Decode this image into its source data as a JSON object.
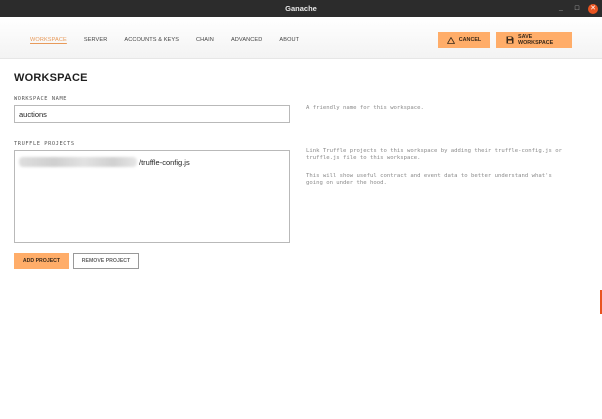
{
  "window": {
    "title": "Ganache",
    "minimize_glyph": "_",
    "maximize_glyph": "□",
    "close_glyph": "✕"
  },
  "nav": {
    "tabs": [
      {
        "label": "WORKSPACE",
        "active": true
      },
      {
        "label": "SERVER",
        "active": false
      },
      {
        "label": "ACCOUNTS & KEYS",
        "active": false
      },
      {
        "label": "CHAIN",
        "active": false
      },
      {
        "label": "ADVANCED",
        "active": false
      },
      {
        "label": "ABOUT",
        "active": false
      }
    ],
    "cancel_label": "CANCEL",
    "save_label": "SAVE WORKSPACE"
  },
  "workspace": {
    "title": "WORKSPACE",
    "name_label": "WORKSPACE NAME",
    "name_value": "auctions",
    "name_help": "A friendly name for this workspace.",
    "projects_label": "TRUFFLE PROJECTS",
    "projects": [
      {
        "path_suffix": "/truffle-config.js"
      }
    ],
    "projects_help_1": "Link Truffle projects to this workspace by adding their truffle-config.js or truffle.js file to this workspace.",
    "projects_help_2": "This will show useful contract and event data to better understand what's going on under the hood.",
    "add_project_label": "ADD PROJECT",
    "remove_project_label": "REMOVE PROJECT"
  },
  "colors": {
    "accent": "#ffad69",
    "active_tab": "#e89a5a",
    "titlebar": "#2c2c2c",
    "close": "#e95420"
  },
  "icons": {
    "cancel": "warning-triangle-icon",
    "save": "floppy-disk-icon"
  }
}
